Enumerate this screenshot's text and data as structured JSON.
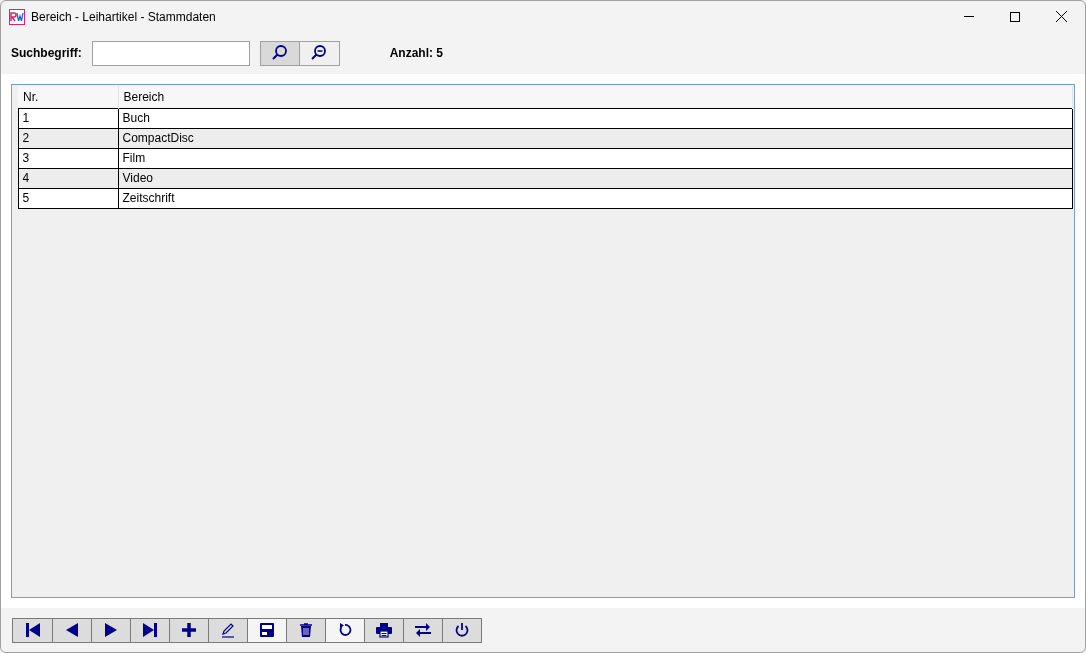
{
  "window": {
    "title": "Bereich - Leihartikel - Stammdaten"
  },
  "search": {
    "label": "Suchbegriff:",
    "buttons": [
      {
        "kind": "search",
        "pressed": true
      },
      {
        "kind": "zoom-out",
        "pressed": false
      }
    ],
    "count": "Anzahl: 5"
  },
  "table": {
    "columns": [
      "Nr.",
      "Bereich"
    ],
    "rows": [
      [
        "1",
        "Buch"
      ],
      [
        "2",
        "CompactDisc"
      ],
      [
        "3",
        "Film"
      ],
      [
        "4",
        "Video"
      ],
      [
        "5",
        "Zeitschrift"
      ]
    ]
  },
  "toolbar": [
    {
      "kind": "first",
      "disabled": false
    },
    {
      "kind": "prev",
      "disabled": false
    },
    {
      "kind": "next",
      "disabled": false
    },
    {
      "kind": "last",
      "disabled": false
    },
    {
      "kind": "add",
      "disabled": false
    },
    {
      "kind": "edit",
      "disabled": false
    },
    {
      "kind": "save",
      "disabled": true
    },
    {
      "kind": "delete",
      "disabled": false
    },
    {
      "kind": "undo",
      "disabled": true
    },
    {
      "kind": "print",
      "disabled": false
    },
    {
      "kind": "swap",
      "disabled": false
    },
    {
      "kind": "power",
      "disabled": false
    }
  ]
}
